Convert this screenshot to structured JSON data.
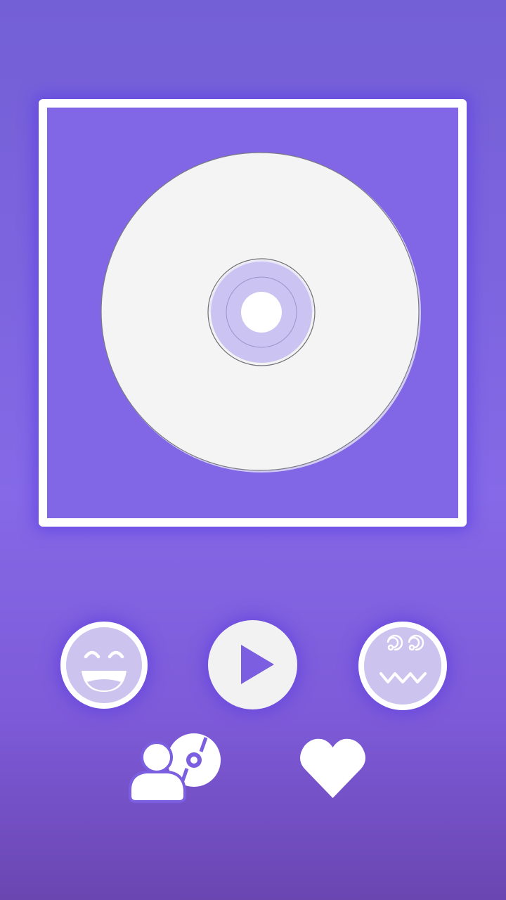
{
  "screen": {
    "name": "music-player-mood-screen",
    "colors": {
      "background_top": "#735fd6",
      "background_bottom": "#6a46b1",
      "album_frame": "#ffffff",
      "album_bg": "#8167e5",
      "disc": "#f4f4f4",
      "disc_hub": "#cbc3f2",
      "button_face_fill": "#ccc3ef",
      "play_button_fill": "#f2f2f2",
      "accent": "#7b5fe0"
    }
  },
  "album_art": {
    "icon": "cd-disc-icon"
  },
  "controls": {
    "happy_button": {
      "icon": "happy-face-icon"
    },
    "play_button": {
      "icon": "play-icon"
    },
    "dizzy_button": {
      "icon": "dizzy-face-icon"
    },
    "artist_library_button": {
      "icon": "user-disc-icon"
    },
    "favorite_button": {
      "icon": "heart-icon"
    }
  }
}
